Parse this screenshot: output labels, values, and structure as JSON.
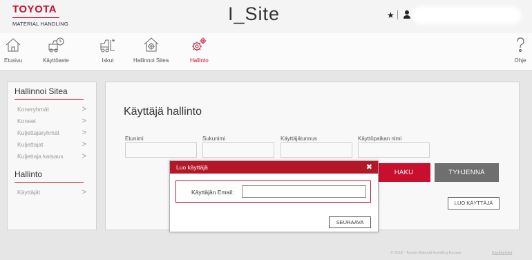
{
  "brand": {
    "name": "TOYOTA",
    "subtitle": "MATERIAL HANDLING"
  },
  "app": {
    "title": "I_Site"
  },
  "header": {
    "star_icon": "star-icon",
    "user_icon": "user-icon"
  },
  "nav": {
    "items": [
      {
        "label": "Etusivu",
        "icon": "home-icon"
      },
      {
        "label": "Käyttöaste",
        "icon": "forklift-clock-icon"
      },
      {
        "label": "Iskut",
        "icon": "forklift-impact-icon"
      },
      {
        "label": "Hallinnoi Sitea",
        "icon": "site-gear-icon"
      },
      {
        "label": "Hallinto",
        "icon": "gears-icon",
        "active": true
      },
      {
        "label": "Ohje",
        "icon": "question-icon"
      }
    ],
    "accent": "#c8102e"
  },
  "sidebar": {
    "section1": {
      "title": "Hallinnoi Sitea",
      "items": [
        "Koneryhmät",
        "Koneet",
        "Kuljettajaryhmät",
        "Kuljettajat",
        "Kuljettaja katsaus"
      ]
    },
    "section2": {
      "title": "Hallinto",
      "items": [
        "Käyttäjät"
      ]
    }
  },
  "main": {
    "title": "Käyttäjä hallinto",
    "fields": [
      {
        "label": "Etunimi",
        "value": ""
      },
      {
        "label": "Sukunimi",
        "value": ""
      },
      {
        "label": "Käyttäjätunnus",
        "value": ""
      },
      {
        "label": "Käyttöpaikan nimi",
        "value": ""
      }
    ],
    "search_button": "HAKU",
    "clear_button": "TYHJENNÄ",
    "create_button": "LUO KÄYTTÄJÄ"
  },
  "modal": {
    "title": "Luo käyttäjä",
    "close": "✖",
    "email_label": "Käyttäjän Email:",
    "email_value": "",
    "next_button": "SEURAAVA"
  },
  "footer": {
    "copyright": "© 2018 - Toyota Material Handling Europe",
    "link": "Käyttöehdot"
  }
}
